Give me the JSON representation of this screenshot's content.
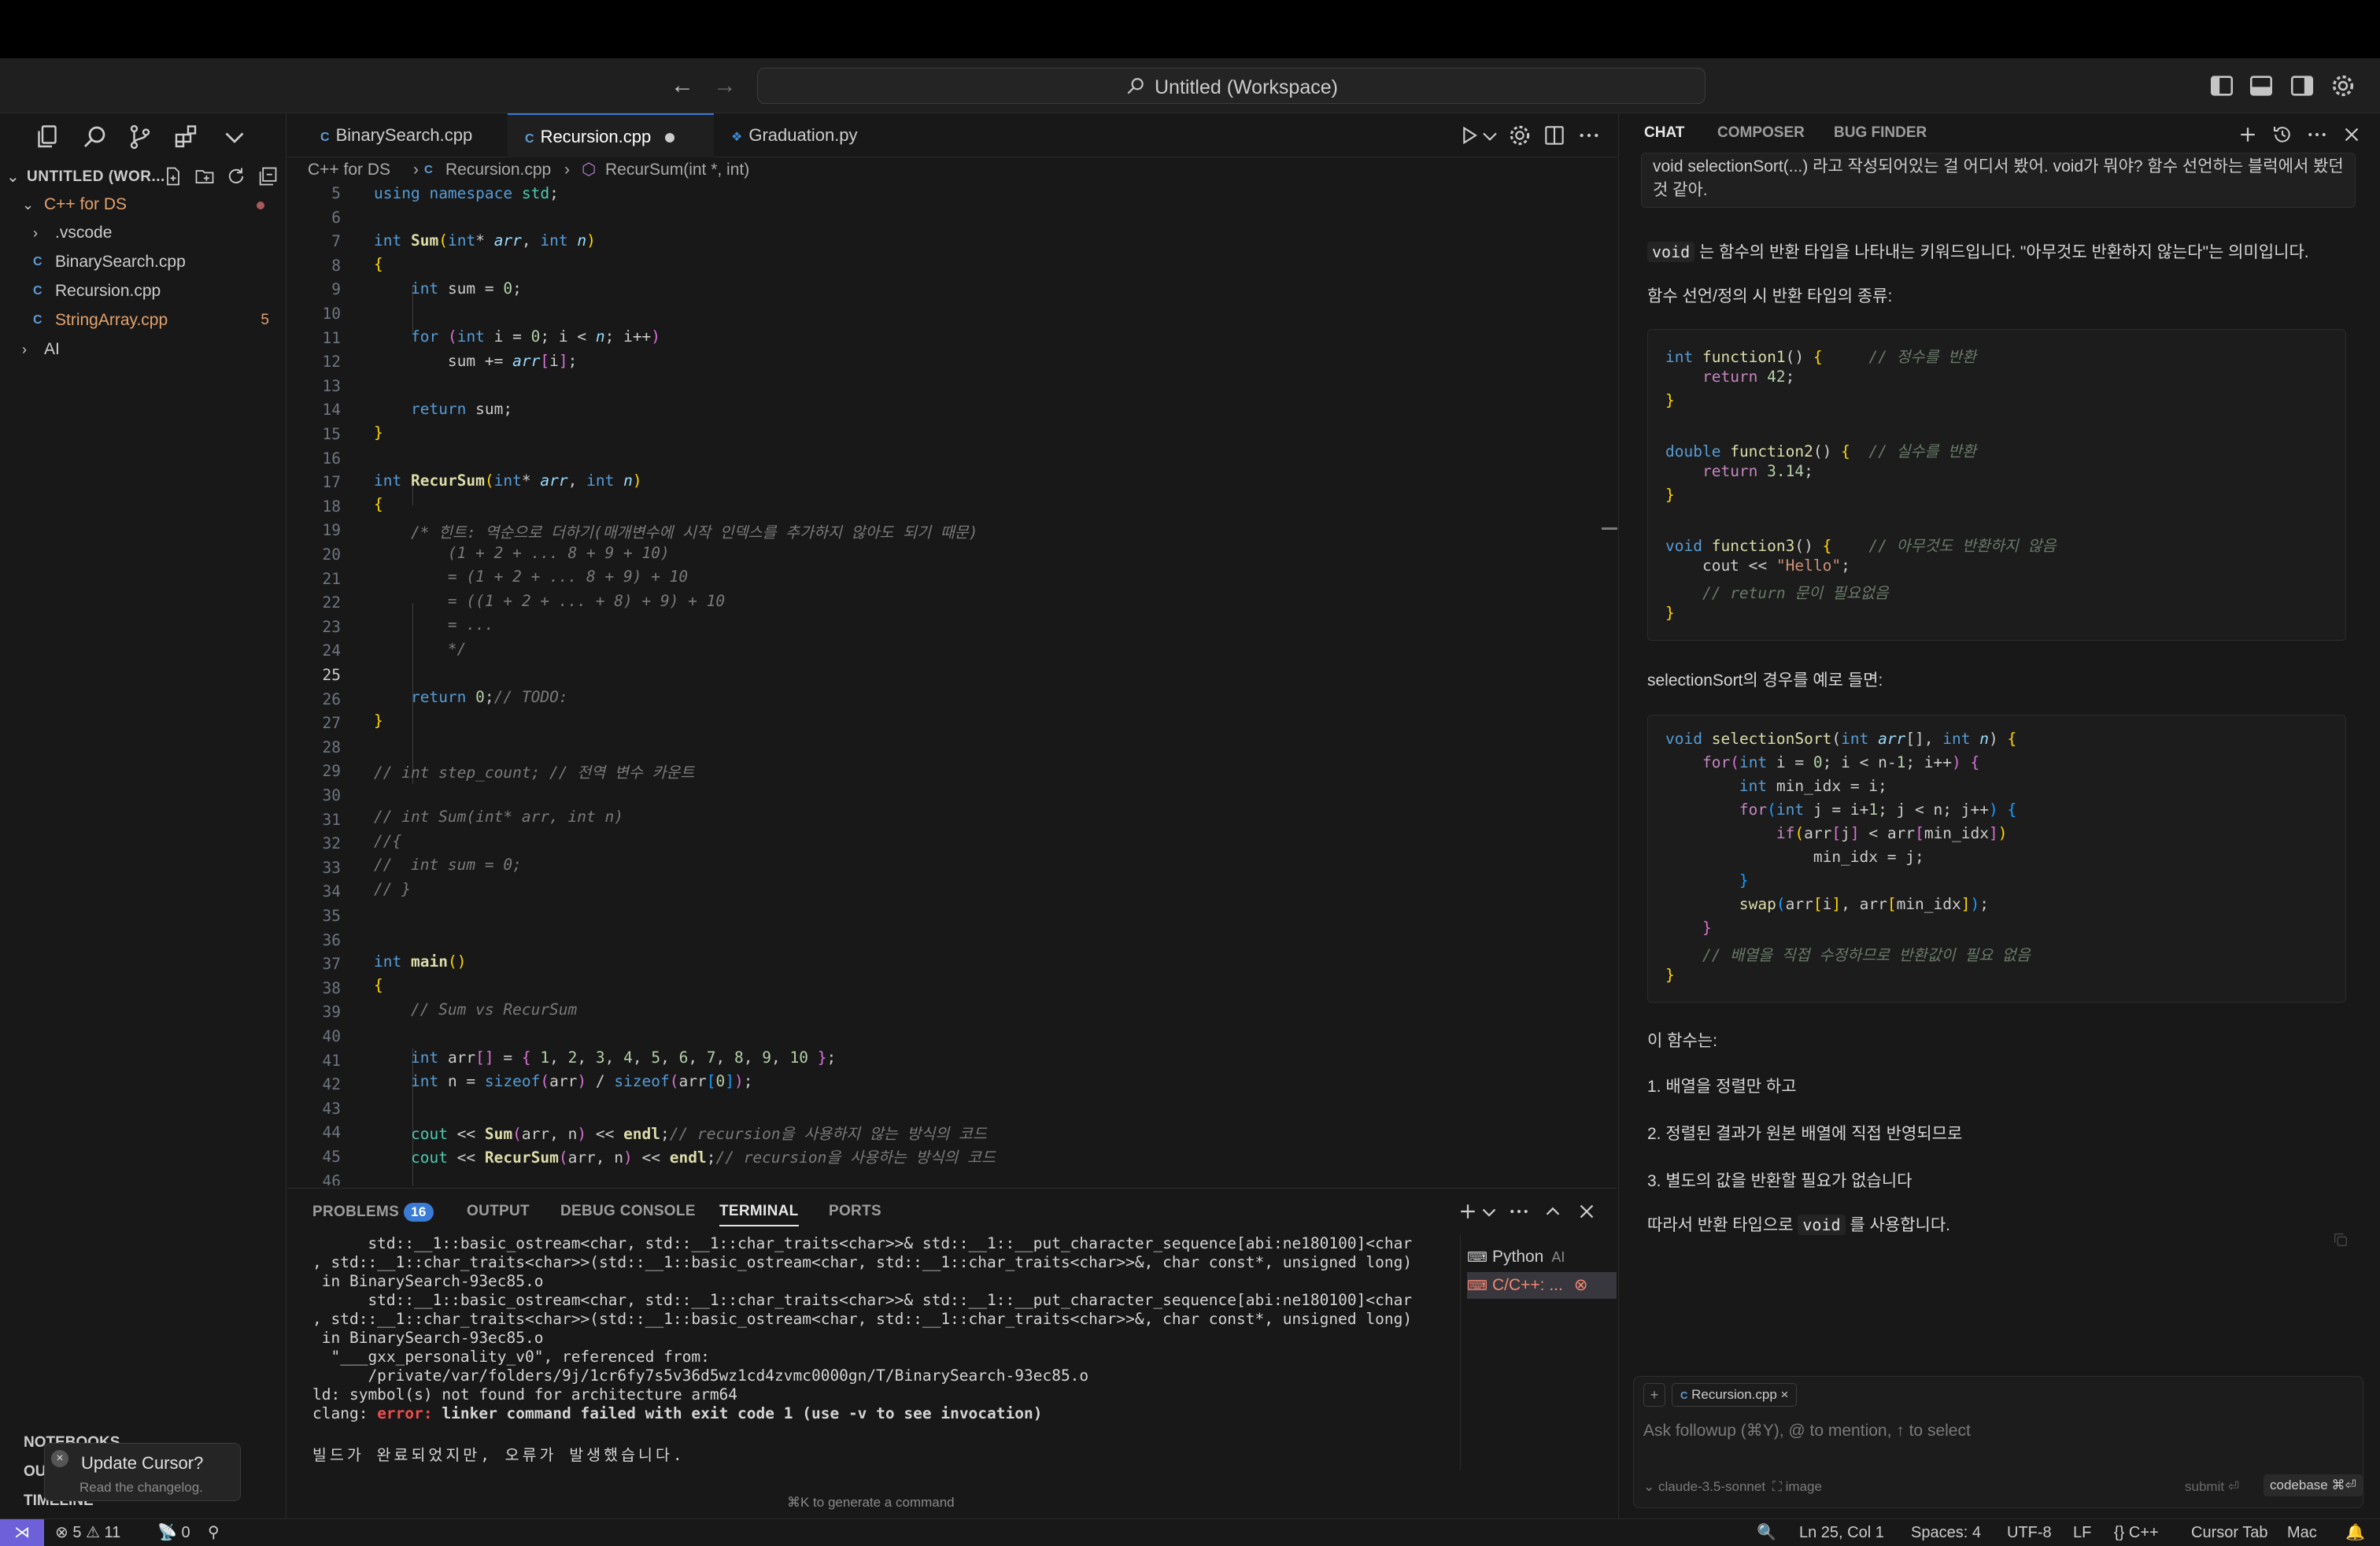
{
  "window": {
    "title": "Untitled (Workspace)"
  },
  "explorer": {
    "header": "UNTITLED (WOR...",
    "folder": "C++ for DS",
    "items": [
      {
        "label": ".vscode",
        "kind": "folder"
      },
      {
        "label": "BinarySearch.cpp",
        "kind": "cpp"
      },
      {
        "label": "Recursion.cpp",
        "kind": "cpp"
      },
      {
        "label": "StringArray.cpp",
        "kind": "cpp",
        "badge": "5"
      },
      {
        "label": "AI",
        "kind": "folder"
      }
    ],
    "sections": [
      "NOTEBOOKS",
      "OUTLINE",
      "TIMELINE"
    ]
  },
  "update_popup": {
    "title": "Update Cursor?",
    "subtitle": "Read the changelog."
  },
  "tabs": [
    {
      "label": "BinarySearch.cpp",
      "icon": "C"
    },
    {
      "label": "Recursion.cpp",
      "icon": "C",
      "active": true,
      "dirty": true
    },
    {
      "label": "Graduation.py",
      "icon": "py"
    }
  ],
  "breadcrumb": {
    "folder": "C++ for DS",
    "file": "Recursion.cpp",
    "symbol": "RecurSum(int *, int)"
  },
  "editor": {
    "line_numbers": [
      "5",
      "6",
      "7",
      "8",
      "9",
      "10",
      "11",
      "12",
      "13",
      "14",
      "15",
      "16",
      "17",
      "18",
      "19",
      "20",
      "21",
      "22",
      "23",
      "24",
      "25",
      "26",
      "27",
      "28",
      "29",
      "30",
      "31",
      "32",
      "33",
      "34",
      "35",
      "36",
      "37",
      "38",
      "39",
      "40",
      "41",
      "42",
      "43",
      "44",
      "45",
      "46"
    ],
    "current_line": "25"
  },
  "panel": {
    "tabs": [
      "PROBLEMS",
      "OUTPUT",
      "DEBUG CONSOLE",
      "TERMINAL",
      "PORTS"
    ],
    "problems_count": "16",
    "active_tab": "TERMINAL",
    "terminal_lines": [
      "      std::__1::basic_ostream<char, std::__1::char_traits<char>>& std::__1::__put_character_sequence[abi:ne180100]<char",
      ", std::__1::char_traits<char>>(std::__1::basic_ostream<char, std::__1::char_traits<char>>&, char const*, unsigned long)",
      " in BinarySearch-93ec85.o",
      "      std::__1::basic_ostream<char, std::__1::char_traits<char>>& std::__1::__put_character_sequence[abi:ne180100]<char",
      ", std::__1::char_traits<char>>(std::__1::basic_ostream<char, std::__1::char_traits<char>>&, char const*, unsigned long)",
      " in BinarySearch-93ec85.o",
      "  \"___gxx_personality_v0\", referenced from:",
      "      /private/var/folders/9j/1cr6fy7s5v36d5wz1cd4zvmc0000gn/T/BinarySearch-93ec85.o",
      "ld: symbol(s) not found for architecture arm64"
    ],
    "clang_prefix": "clang: ",
    "clang_error": "error:",
    "clang_msg": " linker command failed with exit code 1 (use -v to see invocation)",
    "korean_msg": "빌드가 완료되었지만, 오류가 발생했습니다.",
    "terminals": [
      {
        "label": "Python",
        "tag": "AI"
      },
      {
        "label": "C/C++: ..."
      }
    ],
    "generate_hint": "⌘K to generate a command"
  },
  "chat": {
    "tabs": [
      "CHAT",
      "COMPOSER",
      "BUG FINDER"
    ],
    "user_message": "void selectionSort(...) 라고 작성되어있는 걸 어디서 봤어. void가 뭐야? 함수 선언하는 블럭에서 봤던 것 같아.",
    "answer_intro_code": "void",
    "answer_intro_rest": " 는 함수의 반환 타입을 나타내는 키워드입니다. \"아무것도 반환하지 않는다\"는 의미입니다.",
    "types_heading": "함수 선언/정의 시 반환 타입의 종류:",
    "example_heading": "selectionSort의 경우를 예로 들면:",
    "this_func": "이 함수는:",
    "points": [
      "1. 배열을 정렬만 하고",
      "2. 정렬된 결과가 원본 배열에 직접 반영되므로",
      "3. 별도의 값을 반환할 필요가 없습니다"
    ],
    "conclusion_pre": "따라서 반환 타입으로 ",
    "conclusion_code": "void",
    "conclusion_post": " 를 사용합니다.",
    "input": {
      "chip": "Recursion.cpp",
      "placeholder": "Ask followup (⌘Y), @ to mention, ↑ to select",
      "model": "claude-3.5-sonnet",
      "image": "image",
      "submit": "submit ⏎",
      "codebase": "codebase ⌘⏎"
    }
  },
  "status": {
    "errors": "5",
    "warnings": "11",
    "ports": "0",
    "position": "Ln 25, Col 1",
    "spaces": "Spaces: 4",
    "encoding": "UTF-8",
    "eol": "LF",
    "language": "C++",
    "cursor_tab": "Cursor Tab",
    "os": "Mac"
  },
  "icons": [
    "files-icon",
    "search-icon",
    "source-control-icon",
    "extensions-icon",
    "chevron-down-icon",
    "play-icon",
    "gear-icon",
    "split-editor-icon",
    "more-icon",
    "plus-icon",
    "history-icon",
    "close-icon",
    "bell-icon",
    "zoom-icon"
  ]
}
